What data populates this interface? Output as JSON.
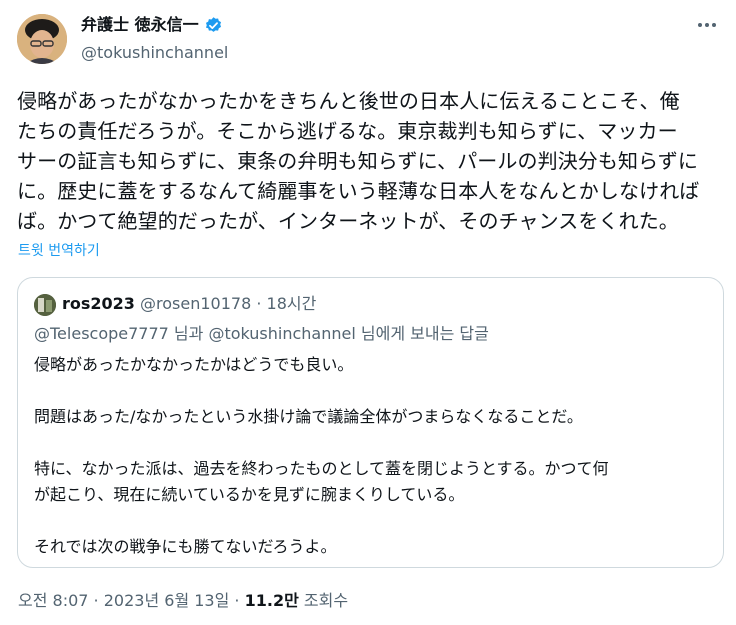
{
  "author": {
    "display_name": "弁護士 徳永信一",
    "handle": "@tokushinchannel",
    "badge": "verified-badge-icon"
  },
  "tweet": {
    "text": "侵略があったがなかったかをきちんと後世の日本人に伝えることこそ、俺\nたちの責任だろうが。そこから逃げるな。東京裁判も知らずに、マッカー\nサーの証言も知らずに、東条の弁明も知らずに、パールの判決分も知らずに\nに。歴史に蓋をするなんて綺麗事をいう軽薄な日本人をなんとかしなければ\nば。かつて絶望的だったが、インターネットが、そのチャンスをくれた。",
    "translate_label": "트윗 번역하기"
  },
  "quote": {
    "name": "ros2023",
    "handle": "@rosen10178",
    "separator": " · ",
    "time": "18시간",
    "reply_to": {
      "mention1": "@Telescope7777",
      "text1": " 님과 ",
      "mention2": "@tokushinchannel",
      "text2": " 님에게 보내는 답글"
    },
    "body": "侵略があったかなかったかはどうでも良い。\n\n問題はあった/なかったという水掛け論で議論全体がつまらなくなることだ。\n\n特に、なかった派は、過去を終わったものとして蓋を閉じようとする。かつて何\nが起こり、現在に続いているかを見ずに腕まくりしている。\n\nそれでは次の戦争にも勝てないだろうよ。"
  },
  "meta": {
    "time": "오전 8:07",
    "separator1": " · ",
    "date": "2023년 6월 13일",
    "separator2": " · ",
    "views_count": "11.2만",
    "views_label": " 조회수"
  },
  "colors": {
    "accent": "#1d9bf0",
    "text": "#0f1419",
    "secondary": "#536471",
    "border": "#cfd9de"
  }
}
